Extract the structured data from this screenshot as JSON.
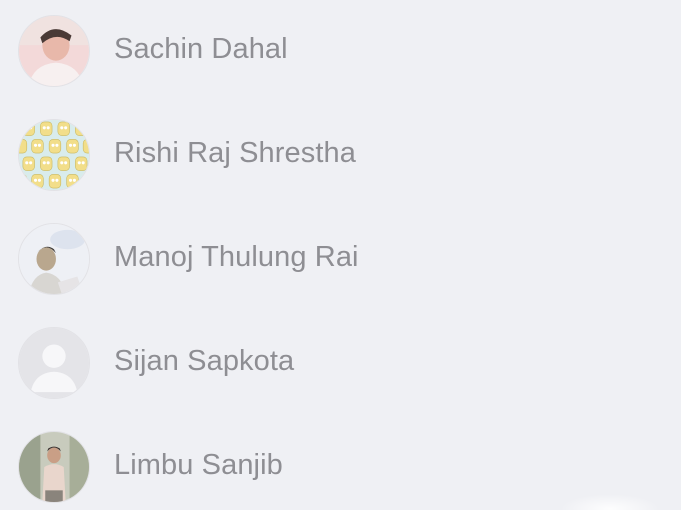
{
  "contacts": [
    {
      "name": "Sachin Dahal",
      "avatar_icon": "person-photo-avatar"
    },
    {
      "name": "Rishi Raj Shrestha",
      "avatar_icon": "cartoon-pattern-avatar"
    },
    {
      "name": "Manoj Thulung Rai",
      "avatar_icon": "person-photo-avatar"
    },
    {
      "name": "Sijan Sapkota",
      "avatar_icon": "default-person-avatar"
    },
    {
      "name": "Limbu Sanjib",
      "avatar_icon": "person-photo-avatar"
    }
  ],
  "colors": {
    "background": "#eff0f4",
    "name_text": "#8e8e93"
  }
}
